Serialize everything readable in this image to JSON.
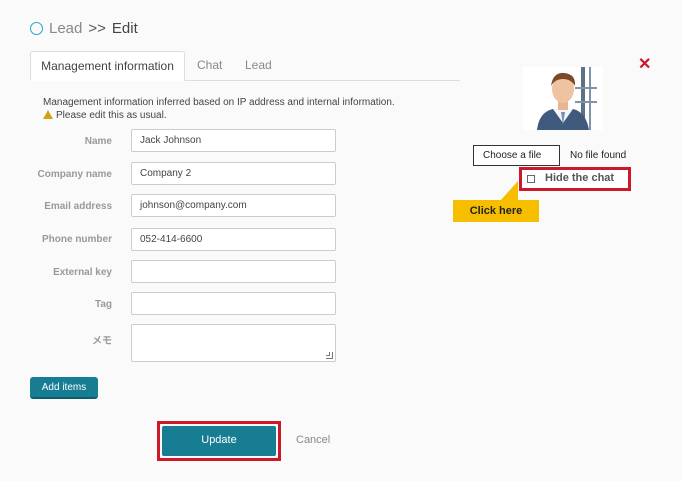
{
  "header": {
    "breadcrumb_lead": "Lead",
    "separator": ">>",
    "page_title": "Edit"
  },
  "tabs": [
    {
      "label": "Management information",
      "active": true
    },
    {
      "label": "Chat",
      "active": false
    },
    {
      "label": "Lead",
      "active": false
    }
  ],
  "info": {
    "line1": "Management information inferred based on IP address and internal information.",
    "line2": "Please edit this as usual."
  },
  "form": {
    "name": {
      "label": "Name",
      "value": "Jack Johnson"
    },
    "company": {
      "label": "Company name",
      "value": "Company 2"
    },
    "email": {
      "label": "Email address",
      "value": "johnson@company.com"
    },
    "phone": {
      "label": "Phone number",
      "value": "052-414-6600"
    },
    "external_key": {
      "label": "External key",
      "value": ""
    },
    "tag": {
      "label": "Tag",
      "value": ""
    },
    "memo": {
      "label": "メモ",
      "value": ""
    }
  },
  "buttons": {
    "add_items": "Add items",
    "update": "Update",
    "cancel": "Cancel"
  },
  "file": {
    "choose_label": "Choose a file",
    "status": "No file found"
  },
  "hide_chat": {
    "label": "Hide the chat",
    "checked": false
  },
  "callout": {
    "text": "Click here"
  },
  "colors": {
    "primary": "#167d92",
    "highlight": "#c9192b",
    "callout": "#f7be00"
  },
  "icons": {
    "close": "close-icon",
    "title": "circle-icon",
    "warning": "warning-icon"
  }
}
